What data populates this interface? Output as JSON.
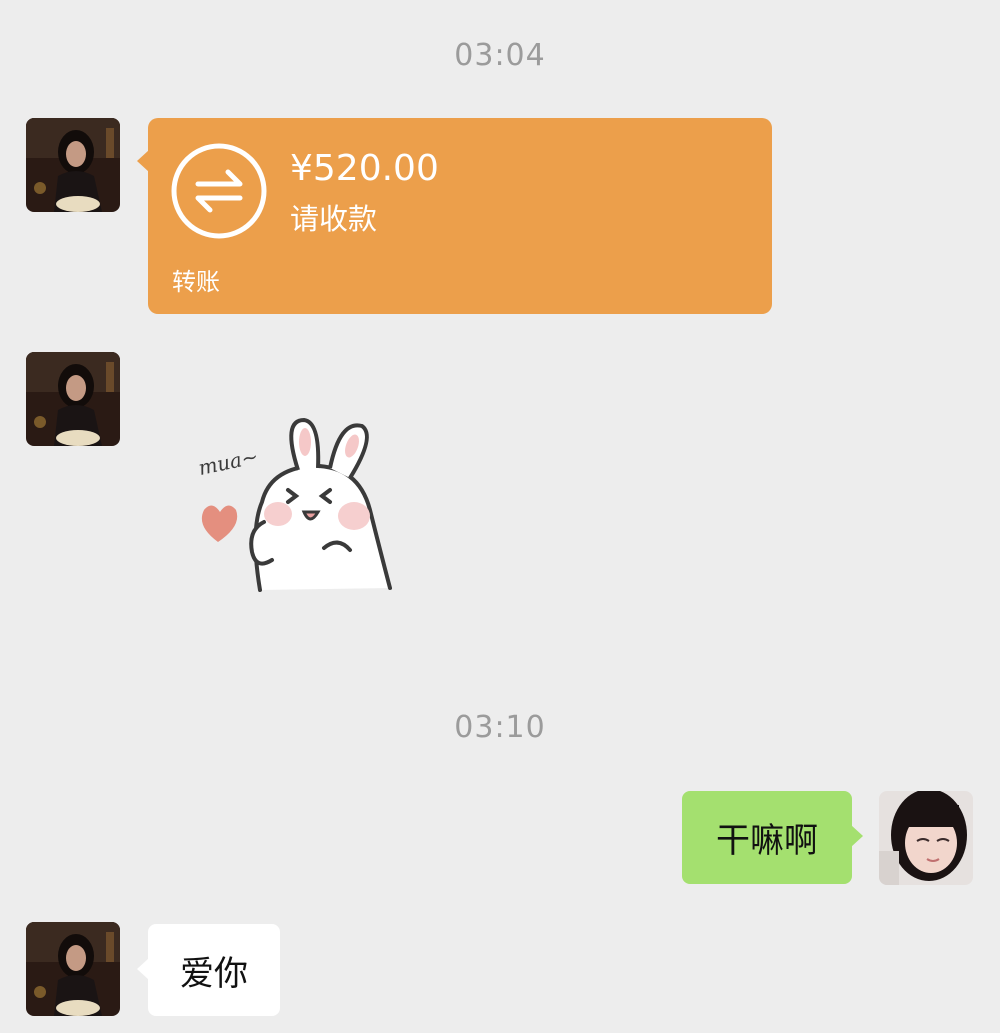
{
  "timestamps": [
    "03:04",
    "03:10"
  ],
  "transfer": {
    "amount": "¥520.00",
    "status": "请收款",
    "label": "转账",
    "icon": "transfer-arrows-icon",
    "color": "#ec9f4b"
  },
  "sticker": {
    "text": "mua~",
    "icon": "bunny-kiss-sticker"
  },
  "messages": {
    "outgoing": "干嘛啊",
    "incoming": "爱你"
  },
  "colors": {
    "background": "#ededed",
    "outgoing_bubble": "#a4e06f",
    "incoming_bubble": "#ffffff"
  }
}
